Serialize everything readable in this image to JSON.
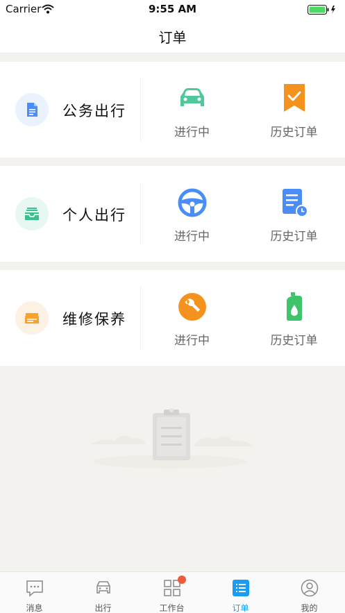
{
  "status_bar": {
    "carrier": "Carrier",
    "time": "9:55 AM"
  },
  "nav": {
    "title": "订单"
  },
  "categories": [
    {
      "label": "公务出行",
      "icon": "document-icon",
      "icon_color": "#4b8df8",
      "icon_bg": "#eaf3fd",
      "actions": [
        {
          "label": "进行中",
          "icon": "car-icon",
          "color": "#4fc99a"
        },
        {
          "label": "历史订单",
          "icon": "bookmark-check-icon",
          "color": "#f5921e"
        }
      ]
    },
    {
      "label": "个人出行",
      "icon": "inbox-icon",
      "icon_color": "#3ec08e",
      "icon_bg": "#e6f8f1",
      "actions": [
        {
          "label": "进行中",
          "icon": "steering-wheel-icon",
          "color": "#4b8df8"
        },
        {
          "label": "历史订单",
          "icon": "document-clock-icon",
          "color": "#4b8df8"
        }
      ]
    },
    {
      "label": "维修保养",
      "icon": "tickets-icon",
      "icon_color": "#f7a12f",
      "icon_bg": "#fdf1e3",
      "actions": [
        {
          "label": "进行中",
          "icon": "wrench-icon",
          "color": "#f5921e"
        },
        {
          "label": "历史订单",
          "icon": "oil-can-icon",
          "color": "#3ec46a"
        }
      ]
    }
  ],
  "tab_bar": {
    "active_color": "#1a9df0",
    "badge_color": "#f05a3a",
    "tabs": [
      {
        "label": "消息",
        "icon": "message-icon",
        "active": false,
        "badge": false
      },
      {
        "label": "出行",
        "icon": "car-icon",
        "active": false,
        "badge": false
      },
      {
        "label": "工作台",
        "icon": "grid-icon",
        "active": false,
        "badge": true
      },
      {
        "label": "订单",
        "icon": "list-icon",
        "active": true,
        "badge": false
      },
      {
        "label": "我的",
        "icon": "profile-icon",
        "active": false,
        "badge": false
      }
    ]
  }
}
